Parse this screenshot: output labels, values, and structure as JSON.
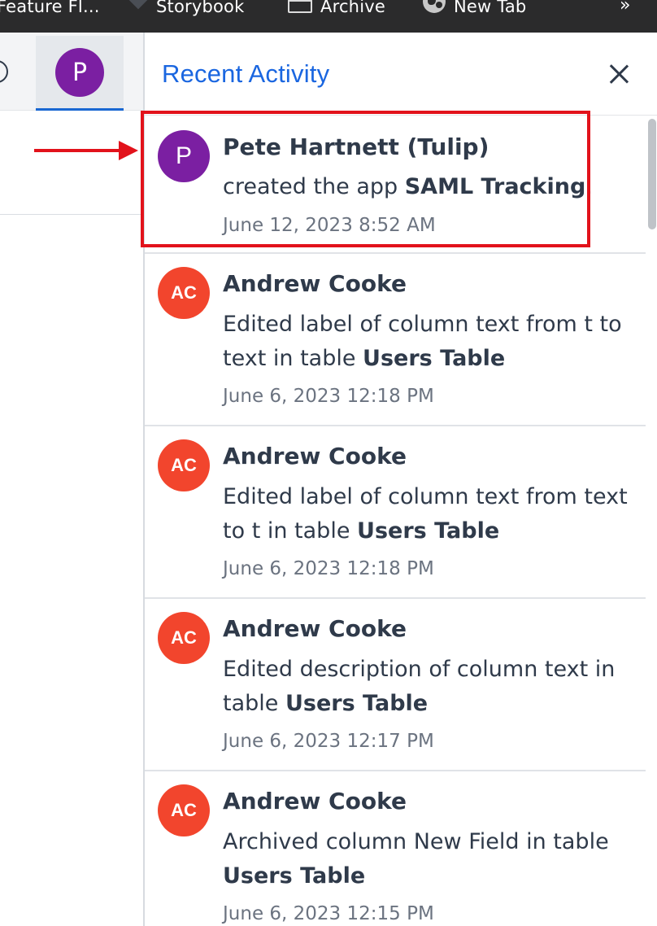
{
  "bookmarks": [
    {
      "label": "Feature Fl...",
      "icon": "folder-icon"
    },
    {
      "label": "Storybook",
      "icon": "storybook-icon"
    },
    {
      "label": "Archive",
      "icon": "archive-icon"
    },
    {
      "label": "New Tab",
      "icon": "globe-icon"
    }
  ],
  "bookmarks_more": "»",
  "header": {
    "avatar_initial": "P"
  },
  "panel": {
    "title": "Recent Activity",
    "close_icon": "close-icon",
    "accent_color": "#1a66e0"
  },
  "activities": [
    {
      "initials": "P",
      "avatar_color": "#7b1fa2",
      "name": "Pete Hartnett (Tulip)",
      "desc_pre": "created the app ",
      "desc_bold": "SAML Tracking",
      "desc_post": ".",
      "time": "June 12, 2023 8:52 AM"
    },
    {
      "initials": "AC",
      "avatar_color": "#f2452d",
      "name": "Andrew Cooke",
      "desc_pre": "Edited label of column text from t to text in table ",
      "desc_bold": "Users Table",
      "desc_post": "",
      "time": "June 6, 2023 12:18 PM"
    },
    {
      "initials": "AC",
      "avatar_color": "#f2452d",
      "name": "Andrew Cooke",
      "desc_pre": "Edited label of column text from text to t in table ",
      "desc_bold": "Users Table",
      "desc_post": "",
      "time": "June 6, 2023 12:18 PM"
    },
    {
      "initials": "AC",
      "avatar_color": "#f2452d",
      "name": "Andrew Cooke",
      "desc_pre": "Edited description of column text in table ",
      "desc_bold": "Users Table",
      "desc_post": "",
      "time": "June 6, 2023 12:17 PM"
    },
    {
      "initials": "AC",
      "avatar_color": "#f2452d",
      "name": "Andrew Cooke",
      "desc_pre": "Archived column New Field in table ",
      "desc_bold": "Users Table",
      "desc_post": "",
      "time": "June 6, 2023 12:15 PM"
    }
  ],
  "annotation": {
    "color": "#e2121b"
  }
}
